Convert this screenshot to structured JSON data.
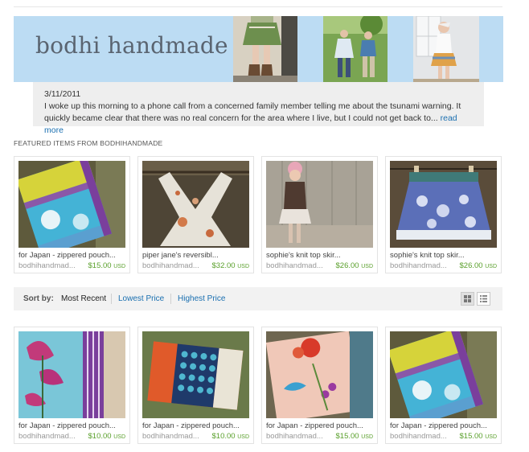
{
  "shop": {
    "title": "bodhi handmade"
  },
  "announcement": {
    "date": "3/11/2011",
    "text": "I woke up this morning to a phone call from a concerned family member telling me about the tsunami warning. It quickly became clear that there was no real concern for the area where I live, but I could not get back to...",
    "link": "read more"
  },
  "featured": {
    "label": "FEATURED ITEMS FROM BODHIHANDMADE",
    "items": [
      {
        "title": "for Japan - zippered pouch...",
        "seller": "bodhihandmad...",
        "price": "$15.00",
        "currency": "USD"
      },
      {
        "title": "piper jane's reversibl...",
        "seller": "bodhihandmad...",
        "price": "$32.00",
        "currency": "USD"
      },
      {
        "title": "sophie's knit top skir...",
        "seller": "bodhihandmad...",
        "price": "$26.00",
        "currency": "USD"
      },
      {
        "title": "sophie's knit top skir...",
        "seller": "bodhihandmad...",
        "price": "$26.00",
        "currency": "USD"
      }
    ]
  },
  "sort": {
    "label": "Sort by:",
    "options": [
      "Most Recent",
      "Lowest Price",
      "Highest Price"
    ],
    "selected": "Most Recent",
    "view_modes": [
      "grid-view-icon",
      "list-view-icon"
    ]
  },
  "listings": {
    "items": [
      {
        "title": "for Japan - zippered pouch...",
        "seller": "bodhihandmad...",
        "price": "$10.00",
        "currency": "USD"
      },
      {
        "title": "for Japan - zippered pouch...",
        "seller": "bodhihandmad...",
        "price": "$10.00",
        "currency": "USD"
      },
      {
        "title": "for Japan - zippered pouch...",
        "seller": "bodhihandmad...",
        "price": "$15.00",
        "currency": "USD"
      },
      {
        "title": "for Japan - zippered pouch...",
        "seller": "bodhihandmad...",
        "price": "$15.00",
        "currency": "USD"
      }
    ]
  },
  "colors": {
    "banner": "#bcdcf3",
    "link": "#1a6fb0",
    "price": "#5aa02c"
  }
}
